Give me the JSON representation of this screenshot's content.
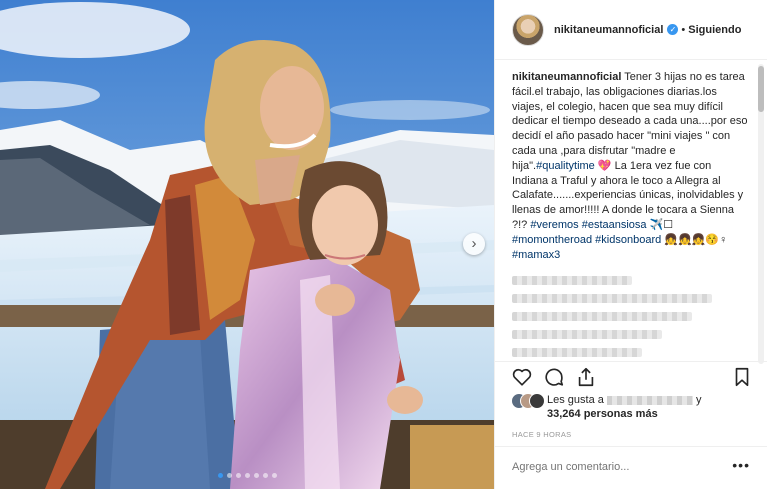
{
  "post": {
    "username": "nikitaneumannoficial",
    "verified_icon": "verified-badge-icon",
    "separator": "•",
    "follow_status": "Siguiendo",
    "next_icon": "chevron-right-icon",
    "carousel_dots": 7,
    "carousel_active": 1
  },
  "caption": {
    "username": "nikitaneumannoficial",
    "text1": " Tener 3 hijas no es tarea fácil.el trabajo, las obligaciones diarias.los viajes, el colegio, hacen que sea muy difícil dedicar el tiempo deseado a cada una....por eso decidí el año pasado hacer \"mini viajes \" con cada una ,para disfrutar \"madre e hija\".",
    "tag_qualitytime": "#qualitytime",
    "emoji_heart": " 💖",
    "text2": " La 1era vez fue con Indiana a Traful y ahora le toco a Allegra al Calafate.......experiencias únicas, inolvidables y llenas de amor!!!!! A donde le tocara a Sienna ?!? ",
    "tag_veremos": "#veremos",
    "tag_estaansiosa": "#estaansiosa",
    "emoji_plane": " ✈️☐ ",
    "tag_momontheroad": "#momontheroad",
    "tag_kidsonboard": "#kidsonboard",
    "emoji_girls": " 👧👧👧😚♀ ",
    "tag_mamax3": "#mamax3"
  },
  "actions": {
    "like_icon": "heart-icon",
    "comment_icon": "comment-icon",
    "share_icon": "share-icon",
    "save_icon": "bookmark-icon"
  },
  "likes": {
    "prefix": "Les gusta a",
    "y": "y",
    "count": "33,264 personas más"
  },
  "timestamp": "HACE 9 HORAS",
  "comment": {
    "placeholder": "Agrega un comentario...",
    "more_icon": "more-options-icon",
    "more_label": "•••"
  },
  "colors": {
    "link": "#003569",
    "accent": "#3897f0",
    "muted": "#999999"
  }
}
